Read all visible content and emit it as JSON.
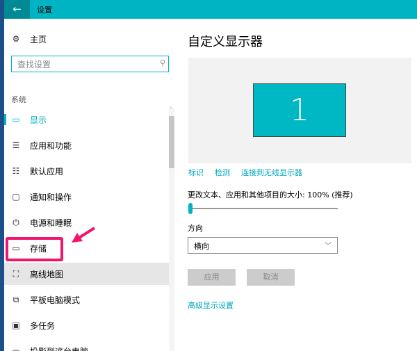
{
  "window": {
    "title": "设置",
    "back_icon": "arrow-left-icon"
  },
  "sidebar": {
    "home": "主页",
    "search_placeholder": "查找设置",
    "section": "系统",
    "items": [
      {
        "label": "显示",
        "icon": "monitor-icon",
        "glyph": "▭"
      },
      {
        "label": "应用和功能",
        "icon": "list-icon",
        "glyph": "☰"
      },
      {
        "label": "默认应用",
        "icon": "list-check-icon",
        "glyph": "☷"
      },
      {
        "label": "通知和操作",
        "icon": "message-icon",
        "glyph": "▢"
      },
      {
        "label": "电源和睡眠",
        "icon": "power-icon",
        "glyph": "⏻"
      },
      {
        "label": "存储",
        "icon": "storage-icon",
        "glyph": "▭"
      },
      {
        "label": "离线地图",
        "icon": "map-icon",
        "glyph": "⛶"
      },
      {
        "label": "平板电脑模式",
        "icon": "tablet-icon",
        "glyph": "⧉"
      },
      {
        "label": "多任务",
        "icon": "multitask-icon",
        "glyph": "▣"
      },
      {
        "label": "投影到这台电脑",
        "icon": "project-icon",
        "glyph": "▭"
      }
    ]
  },
  "main": {
    "title": "自定义显示器",
    "monitor_number": "1",
    "links": [
      "标识",
      "检测",
      "连接到无线显示器"
    ],
    "scale_label": "更改文本、应用和其他项目的大小: 100% (推荐)",
    "scale_value_percent": 0,
    "orientation_label": "方向",
    "orientation_value": "横向",
    "apply": "应用",
    "cancel": "取消",
    "advanced": "高级显示设置"
  },
  "colors": {
    "accent": "#00b4c4",
    "annotation": "#f0166e"
  }
}
